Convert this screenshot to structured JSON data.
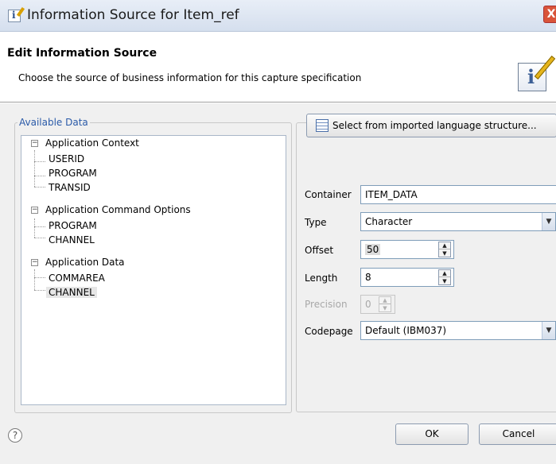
{
  "window": {
    "title": "Information Source for Item_ref",
    "close_label": "X"
  },
  "header": {
    "title": "Edit Information Source",
    "description": "Choose the source of business information for this capture specification"
  },
  "available_data": {
    "label": "Available Data",
    "tree": [
      {
        "label": "Application Context",
        "children": [
          "USERID",
          "PROGRAM",
          "TRANSID"
        ]
      },
      {
        "label": "Application Command Options",
        "children": [
          "PROGRAM",
          "CHANNEL"
        ]
      },
      {
        "label": "Application Data",
        "children": [
          "COMMAREA",
          "CHANNEL"
        ],
        "selected_child": "CHANNEL"
      }
    ]
  },
  "form": {
    "import_button": "Select from imported language structure...",
    "container_label": "Container",
    "container_value": "ITEM_DATA",
    "type_label": "Type",
    "type_value": "Character",
    "offset_label": "Offset",
    "offset_value": "50",
    "length_label": "Length",
    "length_value": "8",
    "precision_label": "Precision",
    "precision_value": "0",
    "codepage_label": "Codepage",
    "codepage_value": "Default (IBM037)"
  },
  "footer": {
    "help": "?",
    "ok": "OK",
    "cancel": "Cancel"
  }
}
